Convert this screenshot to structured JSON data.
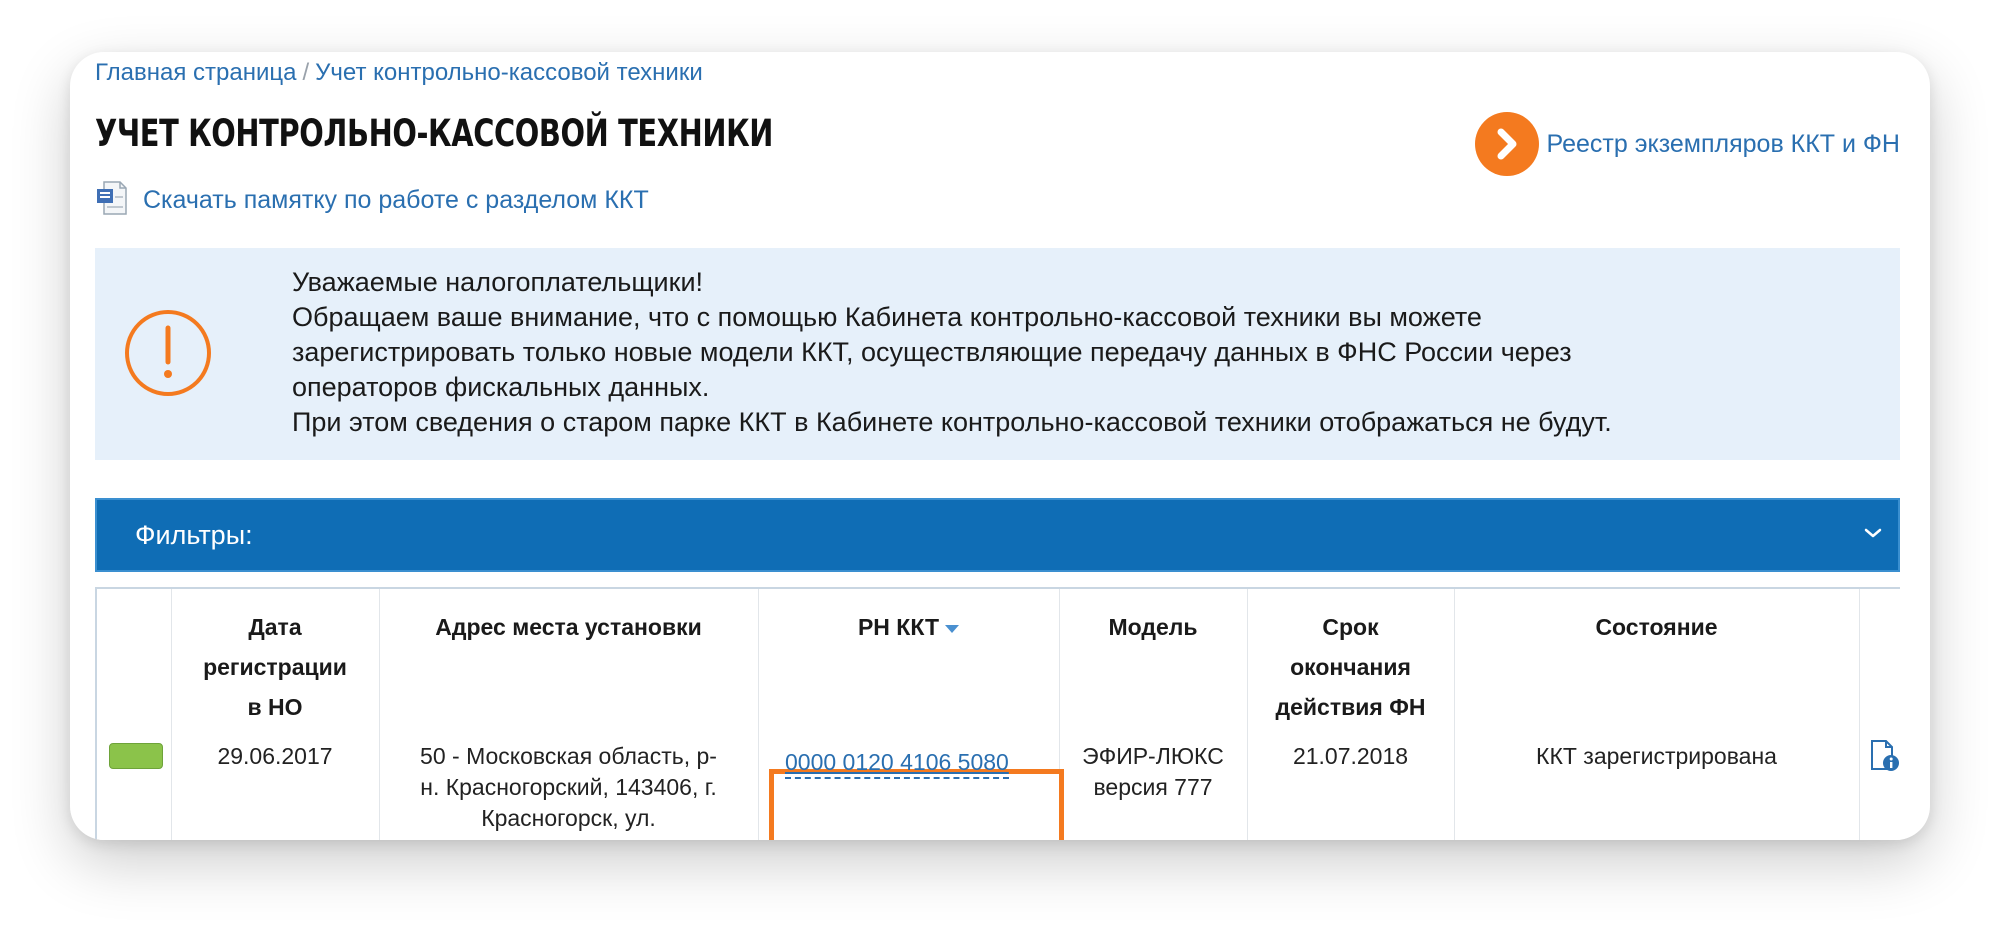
{
  "breadcrumb": {
    "home": "Главная страница",
    "separator": "/",
    "current": "Учет контрольно-кассовой техники"
  },
  "page_title": "Учет контрольно-кассовой техники",
  "registry_link": {
    "label": "Реестр экземпляров ККТ и ФН",
    "icon": "chevron-right-icon"
  },
  "memo_link": {
    "label": "Скачать памятку по работе с разделом ККТ",
    "icon": "document-icon"
  },
  "notice": {
    "icon": "exclamation-circle-icon",
    "lines": [
      "Уважаемые налогоплательщики!",
      "Обращаем ваше внимание, что с помощью Кабинета контрольно-кассовой техники вы можете",
      "зарегистрировать только новые модели ККТ, осуществляющие передачу данных в ФНС России через",
      "операторов фискальных данных.",
      "При этом сведения о старом парке ККТ в Кабинете контрольно-кассовой техники отображаться не будут."
    ]
  },
  "filters": {
    "label": "Фильтры:",
    "icon": "chevron-down-icon"
  },
  "table": {
    "headers": {
      "reg_date": [
        "Дата",
        "регистрации",
        "в НО"
      ],
      "address": [
        "Адрес места установки"
      ],
      "rn": "РН ККТ",
      "model": [
        "Модель"
      ],
      "fn_expiry": [
        "Срок",
        "окончания",
        "действия ФН"
      ],
      "state": [
        "Состояние"
      ]
    },
    "rows": [
      {
        "status_color": "#8bc34a",
        "reg_date": "29.06.2017",
        "address": [
          "50 - Московская область, р-",
          "н. Красногорский, 143406, г.",
          "Красногорск, ул."
        ],
        "rn": "0000 0120 4106 5080",
        "model": [
          "ЭФИР-ЛЮКС",
          "версия 777"
        ],
        "fn_expiry": "21.07.2018",
        "state": "ККТ зарегистрирована",
        "action_icon": "document-info-icon"
      }
    ]
  },
  "colors": {
    "link": "#2a6fb0",
    "accent_orange": "#f47a1f",
    "filters_bg": "#0f6db5",
    "notice_bg": "#e6f0fa",
    "status_green": "#8bc34a"
  }
}
